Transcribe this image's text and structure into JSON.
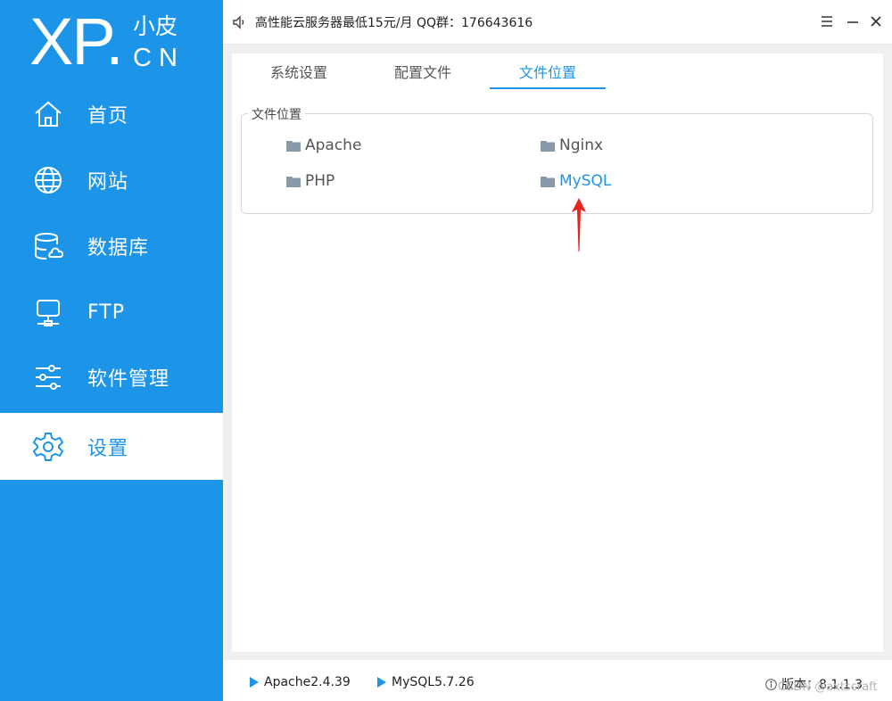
{
  "logo": {
    "mark": "XP.",
    "cn_top": "小皮",
    "cn_bottom": "CN"
  },
  "sidebar": {
    "items": [
      {
        "label": "首页",
        "icon": "home-icon",
        "active": false
      },
      {
        "label": "网站",
        "icon": "globe-icon",
        "active": false
      },
      {
        "label": "数据库",
        "icon": "database-icon",
        "active": false
      },
      {
        "label": "FTP",
        "icon": "monitor-icon",
        "active": false
      },
      {
        "label": "软件管理",
        "icon": "sliders-icon",
        "active": false
      },
      {
        "label": "设置",
        "icon": "gear-icon",
        "active": true
      }
    ]
  },
  "topbar": {
    "announcement": "高性能云服务器最低15元/月  QQ群：176643616"
  },
  "tabs": [
    {
      "label": "系统设置",
      "active": false
    },
    {
      "label": "配置文件",
      "active": false
    },
    {
      "label": "文件位置",
      "active": true
    }
  ],
  "file_locations": {
    "legend": "文件位置",
    "items": [
      {
        "label": "Apache"
      },
      {
        "label": "Nginx"
      },
      {
        "label": "PHP"
      },
      {
        "label": "MySQL"
      }
    ]
  },
  "footer": {
    "services": [
      {
        "label": "Apache2.4.39"
      },
      {
        "label": "MySQL5.7.26"
      }
    ],
    "version": "版本：8.1.1.3",
    "watermark": "CSDN @axtscraft"
  },
  "colors": {
    "accent": "#1c94e8",
    "annotation_arrow": "#e8231c"
  }
}
